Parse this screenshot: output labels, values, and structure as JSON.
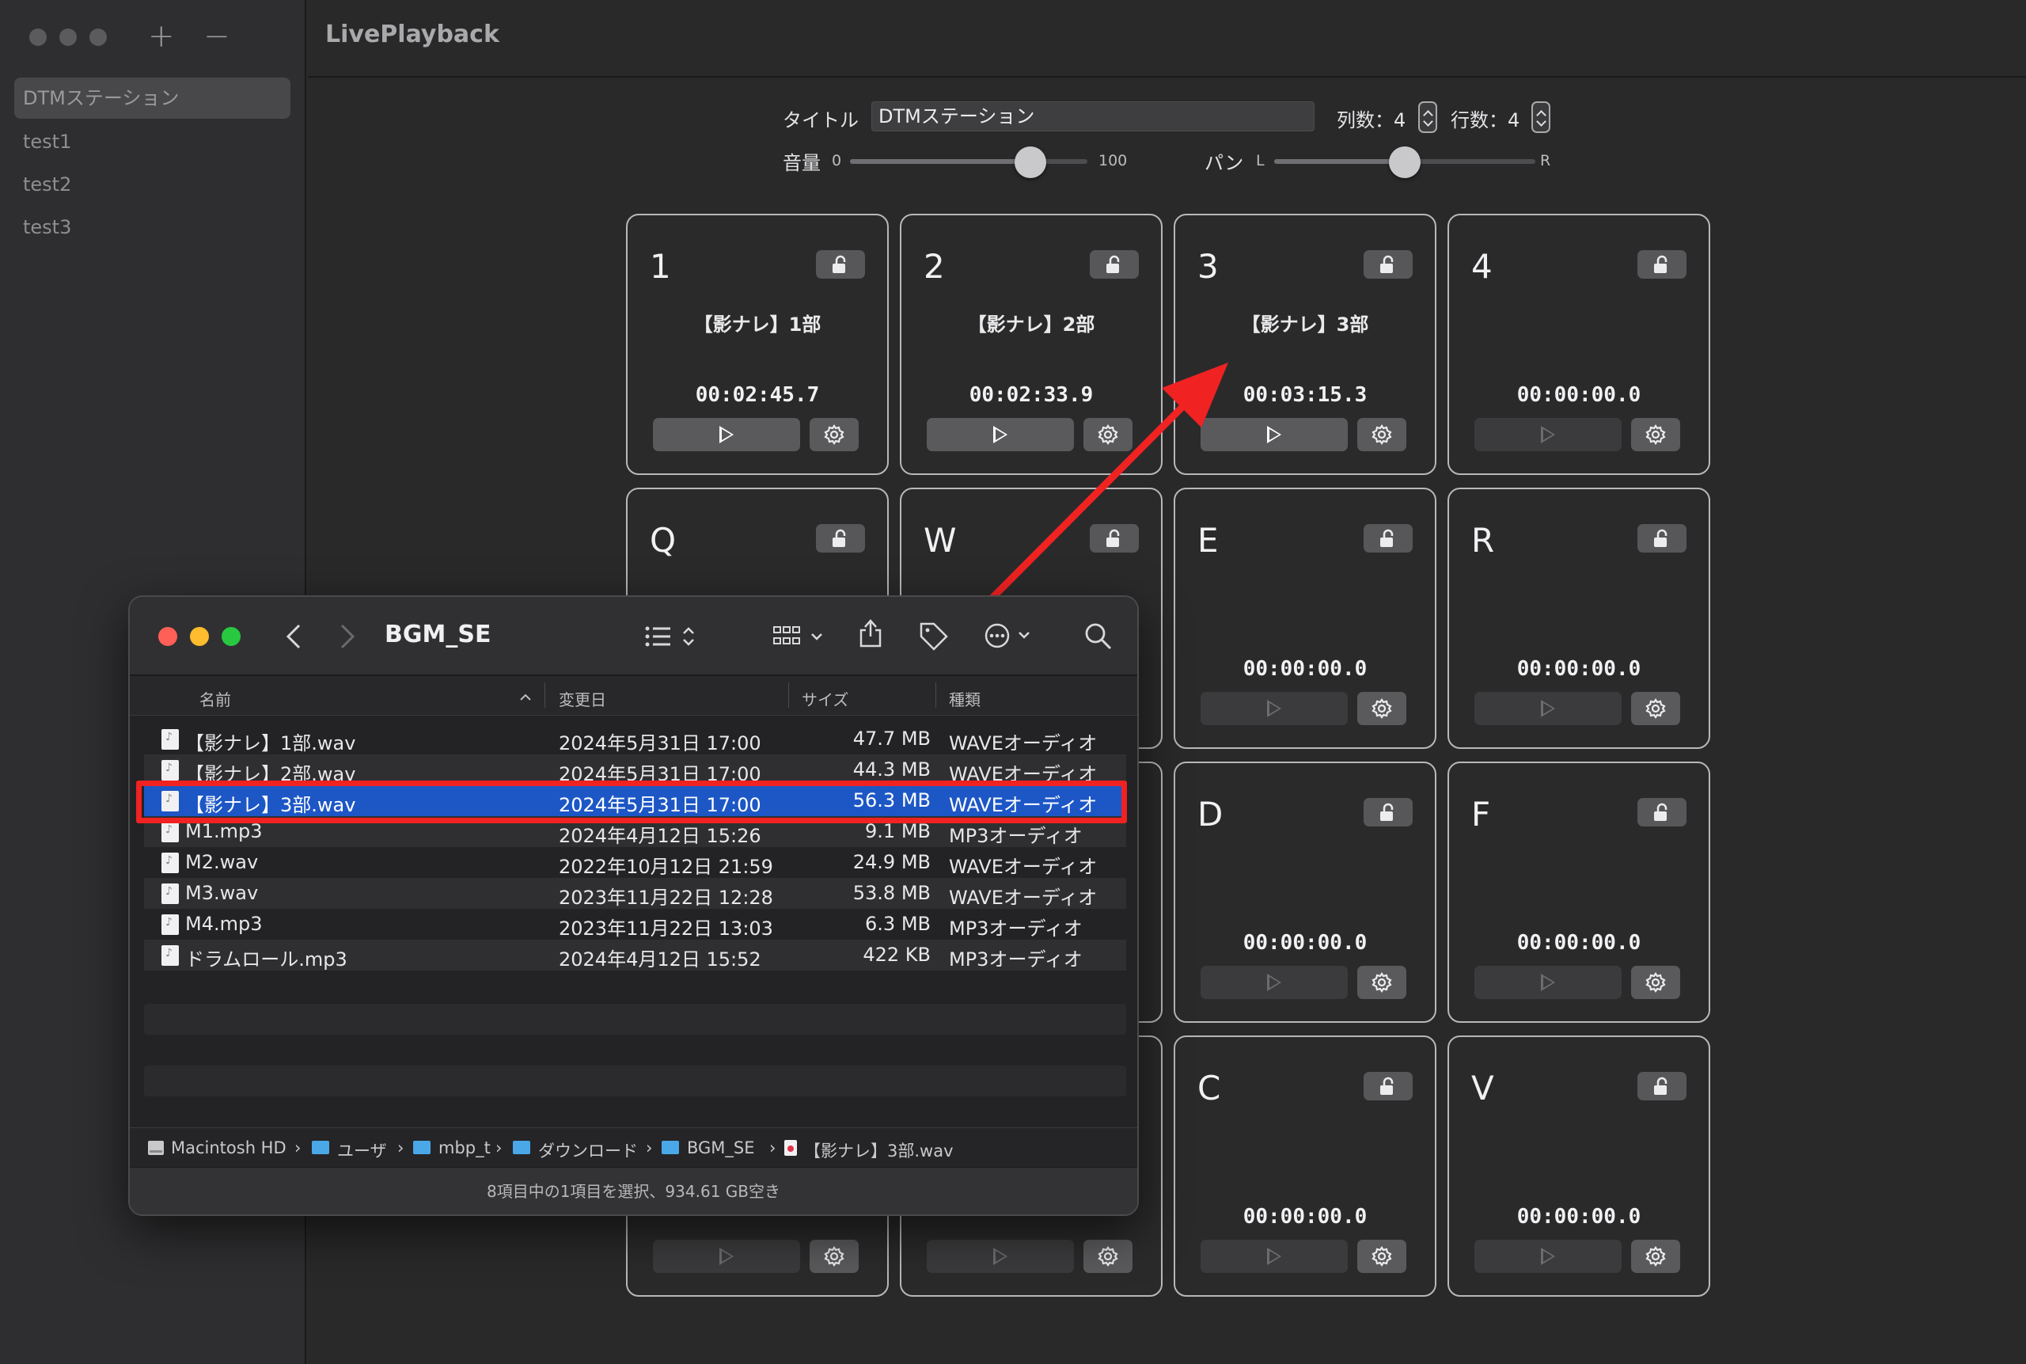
{
  "app": {
    "title": "LivePlayback",
    "sidebar": {
      "add_label": "+",
      "remove_label": "−",
      "items": [
        "DTMステーション",
        "test1",
        "test2",
        "test3"
      ]
    },
    "header": {
      "title_label": "タイトル",
      "title_value": "DTMステーション",
      "cols_label": "列数：4",
      "rows_label": "行数：4",
      "volume_label": "音量",
      "volume_min": "0",
      "volume_max": "100",
      "volume_value": 0.76,
      "pan_label": "パン",
      "pan_left": "L",
      "pan_right": "R",
      "pan_value": 0.5
    },
    "pads": [
      {
        "key": "1",
        "name": "【影ナレ】1部",
        "time": "00:02:45.7",
        "enabled": true
      },
      {
        "key": "2",
        "name": "【影ナレ】2部",
        "time": "00:02:33.9",
        "enabled": true
      },
      {
        "key": "3",
        "name": "【影ナレ】3部",
        "time": "00:03:15.3",
        "enabled": true
      },
      {
        "key": "4",
        "name": "",
        "time": "00:00:00.0",
        "enabled": false
      },
      {
        "key": "Q",
        "name": "",
        "time": "",
        "enabled": false
      },
      {
        "key": "W",
        "name": "",
        "time": "",
        "enabled": false
      },
      {
        "key": "E",
        "name": "",
        "time": "00:00:00.0",
        "enabled": false
      },
      {
        "key": "R",
        "name": "",
        "time": "00:00:00.0",
        "enabled": false
      },
      {
        "key": "",
        "name": "",
        "time": "",
        "enabled": false
      },
      {
        "key": "",
        "name": "",
        "time": "",
        "enabled": false
      },
      {
        "key": "D",
        "name": "",
        "time": "00:00:00.0",
        "enabled": false
      },
      {
        "key": "F",
        "name": "",
        "time": "00:00:00.0",
        "enabled": false
      },
      {
        "key": "",
        "name": "",
        "time": "",
        "enabled": false
      },
      {
        "key": "",
        "name": "",
        "time": "",
        "enabled": false
      },
      {
        "key": "C",
        "name": "",
        "time": "00:00:00.0",
        "enabled": false
      },
      {
        "key": "V",
        "name": "",
        "time": "00:00:00.0",
        "enabled": false
      }
    ]
  },
  "finder": {
    "title": "BGM_SE",
    "columns": {
      "name": "名前",
      "modified": "変更日",
      "size": "サイズ",
      "kind": "種類"
    },
    "files": [
      {
        "name": "【影ナレ】1部.wav",
        "modified": "2024年5月31日 17:00",
        "size": "47.7 MB",
        "kind": "WAVEオーディオ"
      },
      {
        "name": "【影ナレ】2部.wav",
        "modified": "2024年5月31日 17:00",
        "size": "44.3 MB",
        "kind": "WAVEオーディオ"
      },
      {
        "name": "【影ナレ】3部.wav",
        "modified": "2024年5月31日 17:00",
        "size": "56.3 MB",
        "kind": "WAVEオーディオ"
      },
      {
        "name": "M1.mp3",
        "modified": "2024年4月12日 15:26",
        "size": "9.1 MB",
        "kind": "MP3オーディオ"
      },
      {
        "name": "M2.wav",
        "modified": "2022年10月12日 21:59",
        "size": "24.9 MB",
        "kind": "WAVEオーディオ"
      },
      {
        "name": "M3.wav",
        "modified": "2023年11月22日 12:28",
        "size": "53.8 MB",
        "kind": "WAVEオーディオ"
      },
      {
        "name": "M4.mp3",
        "modified": "2023年11月22日 13:03",
        "size": "6.3 MB",
        "kind": "MP3オーディオ"
      },
      {
        "name": "ドラムロール.mp3",
        "modified": "2024年4月12日 15:52",
        "size": "422 KB",
        "kind": "MP3オーディオ"
      }
    ],
    "selected_index": 2,
    "path": [
      "Macintosh HD",
      "ユーザ",
      "mbp_t",
      "ダウンロード",
      "BGM_SE",
      "【影ナレ】3部.wav"
    ],
    "status": "8項目中の1項目を選択、934.61 GB空き"
  },
  "colors": {
    "highlight": "#f02222",
    "selection": "#1d57c6",
    "close": "#fe5f57",
    "minimize": "#febc2e",
    "zoom": "#28c840"
  }
}
